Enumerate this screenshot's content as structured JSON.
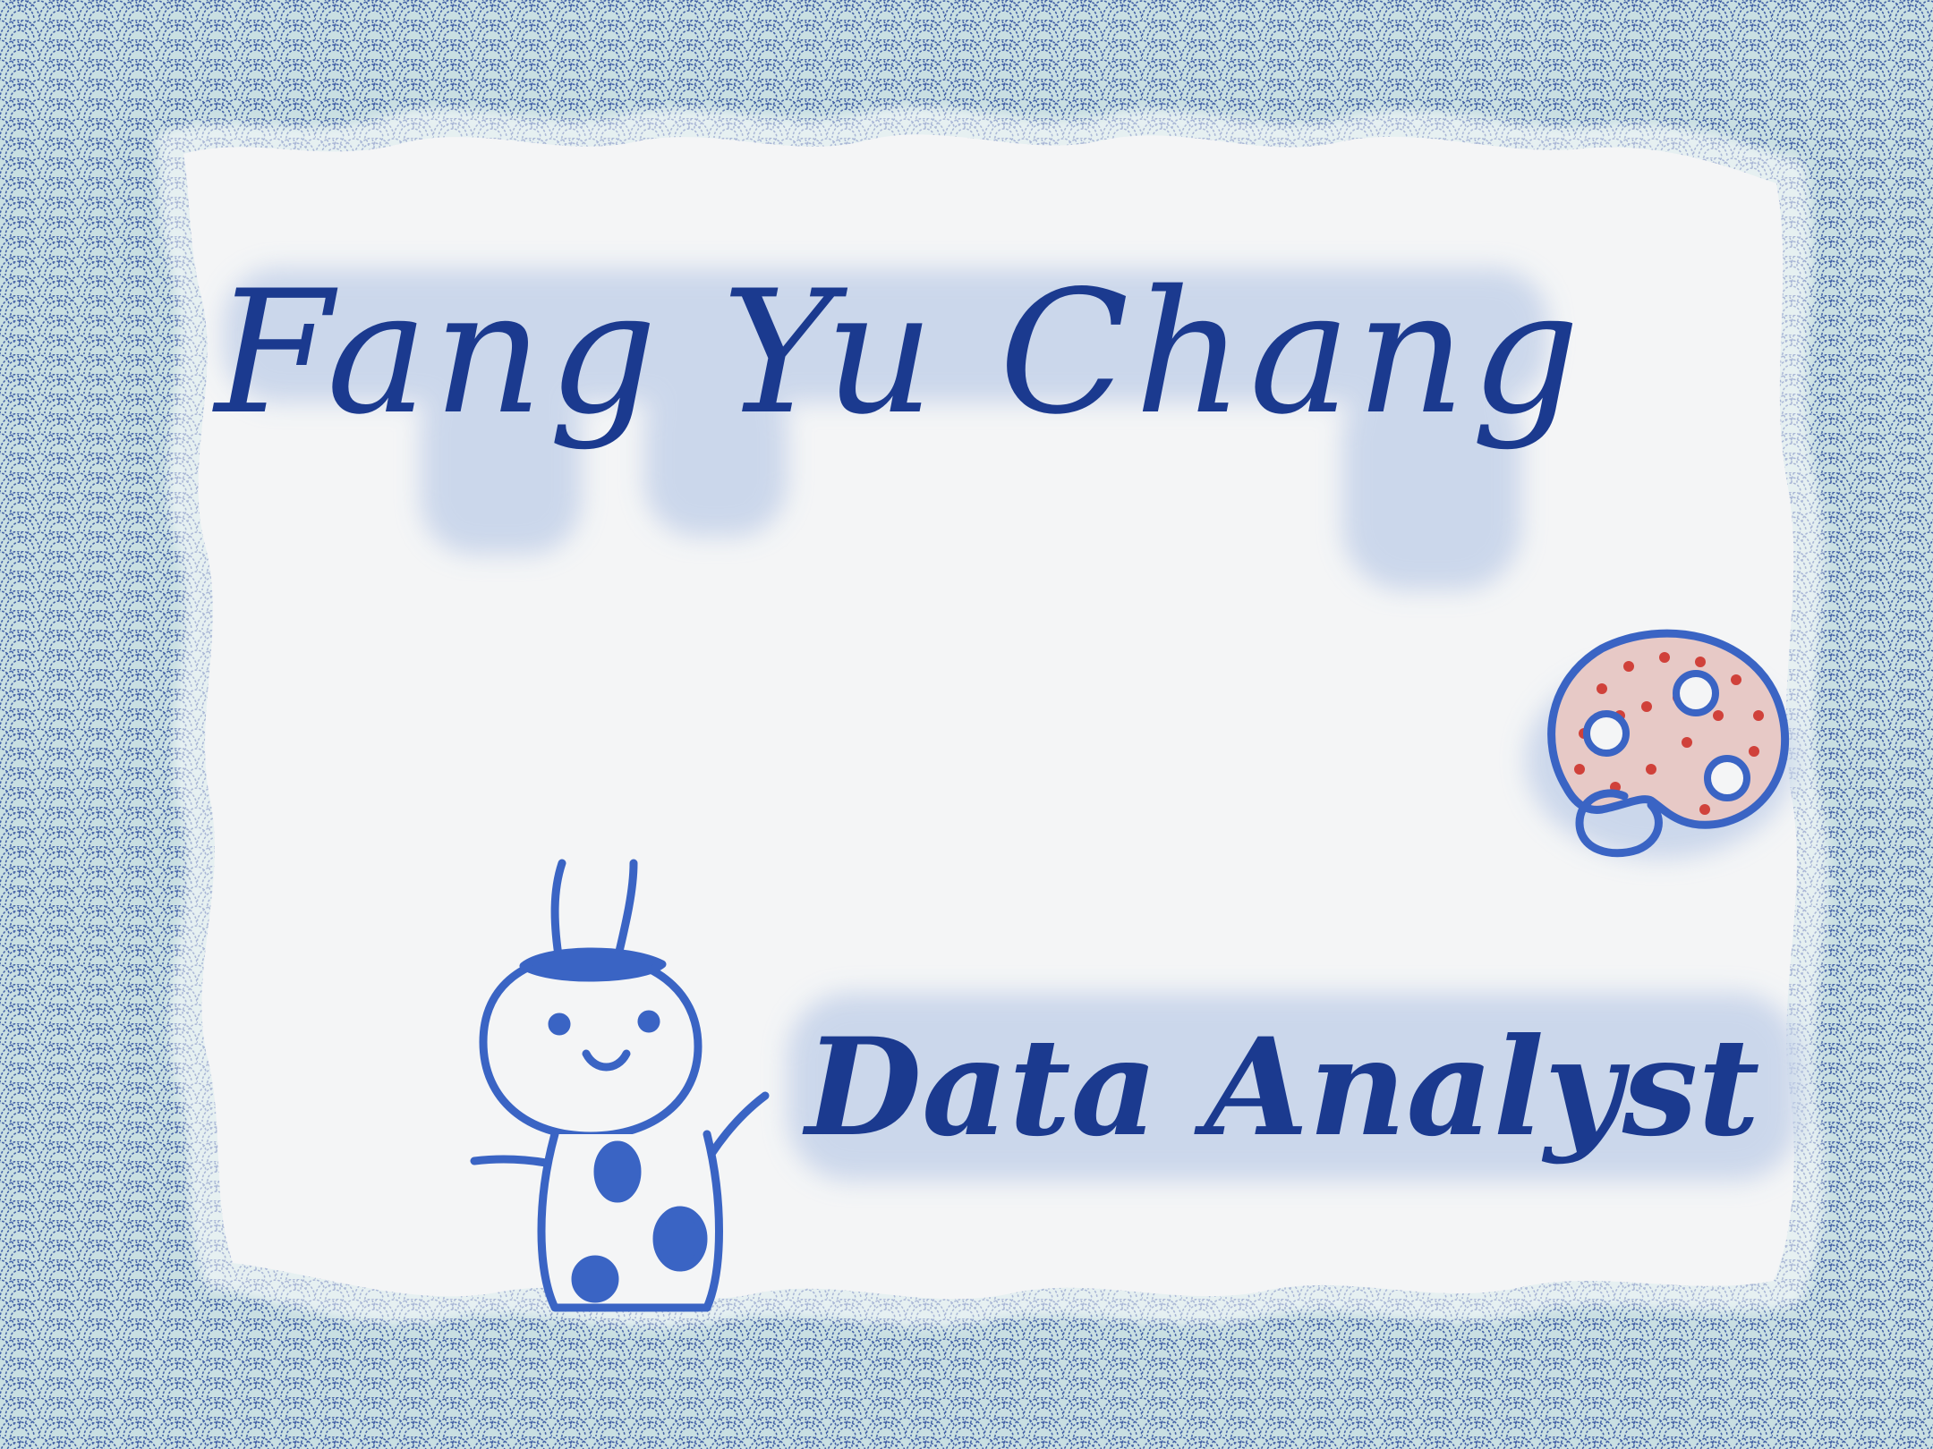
{
  "card": {
    "name": "Fang Yu Chang",
    "role": "Data Analyst"
  },
  "colors": {
    "background_teal": "#c9dfe2",
    "wave_pattern": "#2a4a9a",
    "paper": "#f4f5f6",
    "ink_navy": "#1b3a8f",
    "ink_blue": "#3a64c4",
    "shadow_blue": "#c7d4ea",
    "palette_red": "#cc2a22"
  },
  "illustrations": {
    "mascot": "bug-mascot-waving",
    "palette": "paint-palette-icon"
  }
}
